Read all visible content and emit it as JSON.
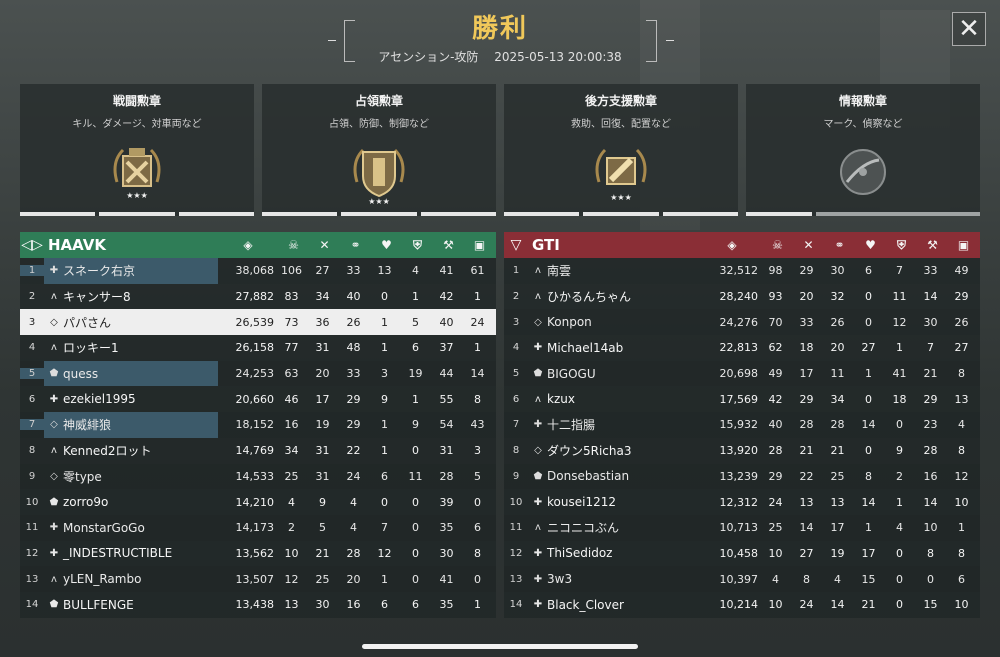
{
  "header": {
    "result": "勝利",
    "mode": "アセンション-攻防",
    "datetime": "2025-05-13 20:00:38"
  },
  "close_icon": "close-icon",
  "medals": [
    {
      "name": "戦闘勲章",
      "desc": "キル、ダメージ、対車両など",
      "icon": "crossed-swords-medal-icon",
      "progress": 3,
      "earned": true
    },
    {
      "name": "占領勲章",
      "desc": "占領、防御、制御など",
      "icon": "shield-medal-icon",
      "progress": 3,
      "earned": true
    },
    {
      "name": "後方支援勲章",
      "desc": "救助、回復、配置など",
      "icon": "supply-medal-icon",
      "progress": 3,
      "earned": true
    },
    {
      "name": "情報勲章",
      "desc": "マーク、偵察など",
      "icon": "radar-medal-icon",
      "progress": 1,
      "earned": false
    }
  ],
  "stat_icons": [
    "score-icon",
    "skull-icon",
    "crossed-swords-icon",
    "handshake-icon",
    "heart-icon",
    "capture-icon",
    "build-icon",
    "supply-icon"
  ],
  "teams": {
    "left": {
      "name": "HAAVK",
      "emblem": "◁▷",
      "color": "#2f7d57",
      "players": [
        {
          "rank": "1",
          "cls": "✚",
          "name": "スネーク右京",
          "stats": [
            "38,068",
            "106",
            "27",
            "33",
            "13",
            "4",
            "41",
            "61"
          ],
          "state": "party"
        },
        {
          "rank": "2",
          "cls": "ʌ",
          "name": "キャンサー8",
          "stats": [
            "27,882",
            "83",
            "34",
            "40",
            "0",
            "1",
            "42",
            "1"
          ],
          "state": ""
        },
        {
          "rank": "3",
          "cls": "◇",
          "name": "パパさん",
          "stats": [
            "26,539",
            "73",
            "36",
            "26",
            "1",
            "5",
            "40",
            "24"
          ],
          "state": "self"
        },
        {
          "rank": "4",
          "cls": "ʌ",
          "name": "ロッキー1",
          "stats": [
            "26,158",
            "77",
            "31",
            "48",
            "1",
            "6",
            "37",
            "1"
          ],
          "state": ""
        },
        {
          "rank": "5",
          "cls": "⬟",
          "name": "quess",
          "stats": [
            "24,253",
            "63",
            "20",
            "33",
            "3",
            "19",
            "44",
            "14"
          ],
          "state": "party"
        },
        {
          "rank": "6",
          "cls": "✚",
          "name": "ezekiel1995",
          "stats": [
            "20,660",
            "46",
            "17",
            "29",
            "9",
            "1",
            "55",
            "8"
          ],
          "state": ""
        },
        {
          "rank": "7",
          "cls": "◇",
          "name": "神威緋狼",
          "stats": [
            "18,152",
            "16",
            "19",
            "29",
            "1",
            "9",
            "54",
            "43"
          ],
          "state": "party"
        },
        {
          "rank": "8",
          "cls": "ʌ",
          "name": "Kenned2ロット",
          "stats": [
            "14,769",
            "34",
            "31",
            "22",
            "1",
            "0",
            "31",
            "3"
          ],
          "state": ""
        },
        {
          "rank": "9",
          "cls": "◇",
          "name": "零type",
          "stats": [
            "14,533",
            "25",
            "31",
            "24",
            "6",
            "11",
            "28",
            "5"
          ],
          "state": ""
        },
        {
          "rank": "10",
          "cls": "⬟",
          "name": "zorro9o",
          "stats": [
            "14,210",
            "4",
            "9",
            "4",
            "0",
            "0",
            "39",
            "0"
          ],
          "state": ""
        },
        {
          "rank": "11",
          "cls": "✚",
          "name": "MonstarGoGo",
          "stats": [
            "14,173",
            "2",
            "5",
            "4",
            "7",
            "0",
            "35",
            "6"
          ],
          "state": ""
        },
        {
          "rank": "12",
          "cls": "✚",
          "name": "_INDESTRUCTIBLE",
          "stats": [
            "13,562",
            "10",
            "21",
            "28",
            "12",
            "0",
            "30",
            "8"
          ],
          "state": ""
        },
        {
          "rank": "13",
          "cls": "ʌ",
          "name": "yLEN_Rambo",
          "stats": [
            "13,507",
            "12",
            "25",
            "20",
            "1",
            "0",
            "41",
            "0"
          ],
          "state": ""
        },
        {
          "rank": "14",
          "cls": "⬟",
          "name": "BULLFENGE",
          "stats": [
            "13,438",
            "13",
            "30",
            "16",
            "6",
            "6",
            "35",
            "1"
          ],
          "state": ""
        }
      ]
    },
    "right": {
      "name": "GTI",
      "emblem": "▽",
      "color": "#8a2e36",
      "players": [
        {
          "rank": "1",
          "cls": "ʌ",
          "name": "南雲",
          "stats": [
            "32,512",
            "98",
            "29",
            "30",
            "6",
            "7",
            "33",
            "49"
          ]
        },
        {
          "rank": "2",
          "cls": "ʌ",
          "name": "ひかるんちゃん",
          "stats": [
            "28,240",
            "93",
            "20",
            "32",
            "0",
            "11",
            "14",
            "29"
          ]
        },
        {
          "rank": "3",
          "cls": "◇",
          "name": "Konpon",
          "stats": [
            "24,276",
            "70",
            "33",
            "26",
            "0",
            "12",
            "30",
            "26"
          ]
        },
        {
          "rank": "4",
          "cls": "✚",
          "name": "Michael14ab",
          "stats": [
            "22,813",
            "62",
            "18",
            "20",
            "27",
            "1",
            "7",
            "27"
          ]
        },
        {
          "rank": "5",
          "cls": "⬟",
          "name": "BIGOGU",
          "stats": [
            "20,698",
            "49",
            "17",
            "11",
            "1",
            "41",
            "21",
            "8"
          ]
        },
        {
          "rank": "6",
          "cls": "ʌ",
          "name": "kzux",
          "stats": [
            "17,569",
            "42",
            "29",
            "34",
            "0",
            "18",
            "29",
            "13"
          ]
        },
        {
          "rank": "7",
          "cls": "✚",
          "name": "十二指腸",
          "stats": [
            "15,932",
            "40",
            "28",
            "28",
            "14",
            "0",
            "23",
            "4"
          ]
        },
        {
          "rank": "8",
          "cls": "◇",
          "name": "ダウン5Richa3",
          "stats": [
            "13,920",
            "28",
            "21",
            "21",
            "0",
            "9",
            "28",
            "8"
          ]
        },
        {
          "rank": "9",
          "cls": "⬟",
          "name": "Donsebastian",
          "stats": [
            "13,239",
            "29",
            "22",
            "25",
            "8",
            "2",
            "16",
            "12"
          ]
        },
        {
          "rank": "10",
          "cls": "✚",
          "name": "kousei1212",
          "stats": [
            "12,312",
            "24",
            "13",
            "13",
            "14",
            "1",
            "14",
            "10"
          ]
        },
        {
          "rank": "11",
          "cls": "ʌ",
          "name": "ニコニコぶん",
          "stats": [
            "10,713",
            "25",
            "14",
            "17",
            "1",
            "4",
            "10",
            "1"
          ]
        },
        {
          "rank": "12",
          "cls": "✚",
          "name": "ThiSedidoz",
          "stats": [
            "10,458",
            "10",
            "27",
            "19",
            "17",
            "0",
            "8",
            "8"
          ]
        },
        {
          "rank": "13",
          "cls": "✚",
          "name": "3w3",
          "stats": [
            "10,397",
            "4",
            "8",
            "4",
            "15",
            "0",
            "0",
            "6"
          ]
        },
        {
          "rank": "14",
          "cls": "✚",
          "name": "Black_Clover",
          "stats": [
            "10,214",
            "10",
            "24",
            "14",
            "21",
            "0",
            "15",
            "10"
          ]
        }
      ]
    }
  }
}
